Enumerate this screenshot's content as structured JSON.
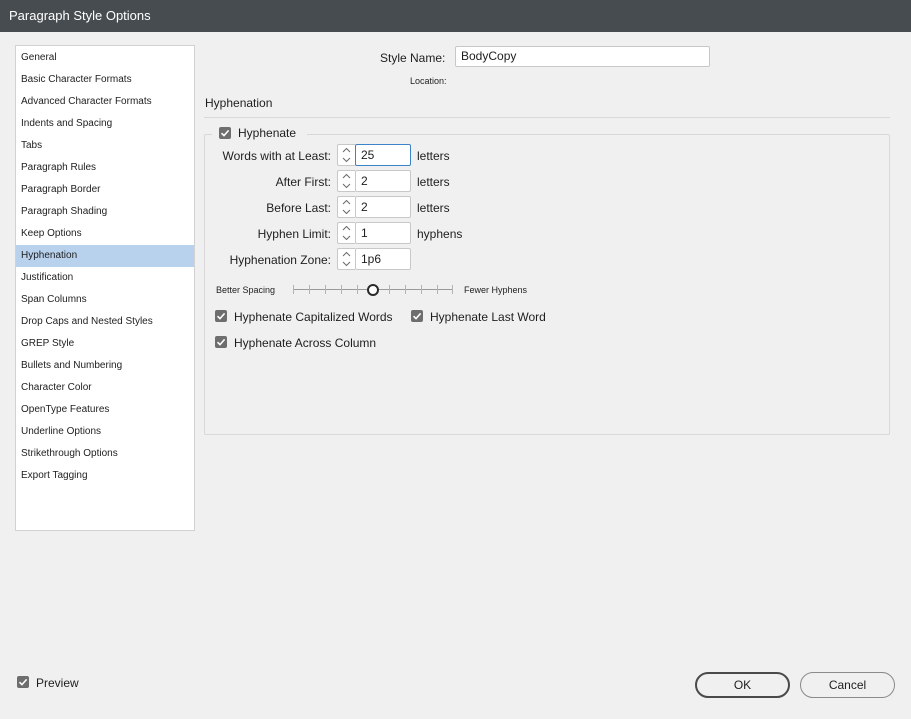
{
  "window": {
    "title": "Paragraph Style Options"
  },
  "sidebar": {
    "items": [
      {
        "label": "General"
      },
      {
        "label": "Basic Character Formats"
      },
      {
        "label": "Advanced Character Formats"
      },
      {
        "label": "Indents and Spacing"
      },
      {
        "label": "Tabs"
      },
      {
        "label": "Paragraph Rules"
      },
      {
        "label": "Paragraph Border"
      },
      {
        "label": "Paragraph Shading"
      },
      {
        "label": "Keep Options"
      },
      {
        "label": "Hyphenation",
        "selected": true
      },
      {
        "label": "Justification"
      },
      {
        "label": "Span Columns"
      },
      {
        "label": "Drop Caps and Nested Styles"
      },
      {
        "label": "GREP Style"
      },
      {
        "label": "Bullets and Numbering"
      },
      {
        "label": "Character Color"
      },
      {
        "label": "OpenType Features"
      },
      {
        "label": "Underline Options"
      },
      {
        "label": "Strikethrough Options"
      },
      {
        "label": "Export Tagging"
      }
    ]
  },
  "header": {
    "style_name_label": "Style Name:",
    "style_name_value": "BodyCopy",
    "location_label": "Location:",
    "section_title": "Hyphenation"
  },
  "hyphenation": {
    "hyphenate_label": "Hyphenate",
    "hyphenate_checked": true,
    "fields": {
      "words_min": {
        "label": "Words with at Least:",
        "value": "25",
        "unit": "letters"
      },
      "after_first": {
        "label": "After First:",
        "value": "2",
        "unit": "letters"
      },
      "before_last": {
        "label": "Before Last:",
        "value": "2",
        "unit": "letters"
      },
      "hyphen_limit": {
        "label": "Hyphen Limit:",
        "value": "1",
        "unit": "hyphens"
      },
      "hyphenation_zone": {
        "label": "Hyphenation Zone:",
        "value": "1p6"
      }
    },
    "slider": {
      "left_label": "Better Spacing",
      "right_label": "Fewer Hyphens",
      "value": 0.5
    },
    "options": {
      "capitalized": {
        "label": "Hyphenate Capitalized Words",
        "checked": true
      },
      "last_word": {
        "label": "Hyphenate Last Word",
        "checked": true
      },
      "across_column": {
        "label": "Hyphenate Across Column",
        "checked": true
      }
    }
  },
  "footer": {
    "preview_label": "Preview",
    "preview_checked": true,
    "ok_label": "OK",
    "cancel_label": "Cancel"
  },
  "colors": {
    "titlebar": "#474c50",
    "selection": "#b8d2ee",
    "focus": "#3c83c7"
  }
}
